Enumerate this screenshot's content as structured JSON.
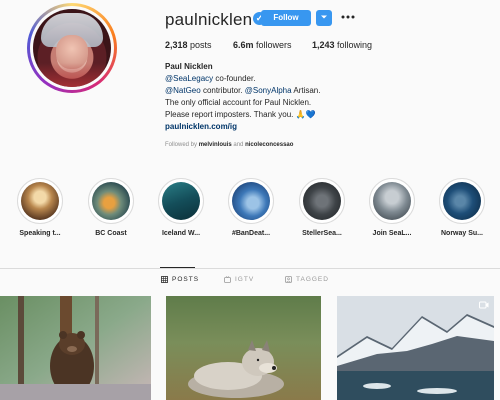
{
  "profile": {
    "username": "paulnicklen",
    "follow_label": "Follow",
    "verified_glyph": "✓",
    "dropdown_icon": "chevron-down-icon",
    "more_icon": "more-horizontal-icon",
    "stats": {
      "posts": "2,318",
      "posts_label": "posts",
      "followers": "6.6m",
      "followers_label": "followers",
      "following": "1,243",
      "following_label": "following"
    },
    "bio": {
      "name": "Paul Nicklen",
      "line1_mention": "@SeaLegacy",
      "line1_rest": "co-founder.",
      "line2_mention1": "@NatGeo",
      "line2_mid": "contributor.",
      "line2_mention2": "@SonyAlpha",
      "line2_rest": "Artisan.",
      "line3": "The only official account for Paul Nicklen.",
      "line4": "Please report imposters. Thank you. 🙏💙",
      "link": "paulnicklen.com/ig"
    },
    "followed_by": {
      "prefix": "Followed by",
      "user1": "melvinlouis",
      "joiner": "and",
      "user2": "nicoleconcessao"
    }
  },
  "highlights": [
    {
      "label": "Speaking t..."
    },
    {
      "label": "BC Coast"
    },
    {
      "label": "Iceland W..."
    },
    {
      "label": "#BanDeat..."
    },
    {
      "label": "StellerSea..."
    },
    {
      "label": "Join SeaL..."
    },
    {
      "label": "Norway Su..."
    }
  ],
  "tabs": [
    {
      "label": "POSTS",
      "icon": "grid-icon",
      "active": true
    },
    {
      "label": "IGTV",
      "icon": "igtv-icon",
      "active": false
    },
    {
      "label": "TAGGED",
      "icon": "tag-icon",
      "active": false
    }
  ],
  "posts": [
    {
      "subject": "bear in forest",
      "icon": ""
    },
    {
      "subject": "wolf lying on grass",
      "icon": ""
    },
    {
      "subject": "snowy mountains and icy water",
      "icon": "video-icon"
    }
  ],
  "colors": {
    "accent": "#3897f0",
    "link": "#003569",
    "muted": "#8e8e8e",
    "border": "#dbdbdb"
  }
}
